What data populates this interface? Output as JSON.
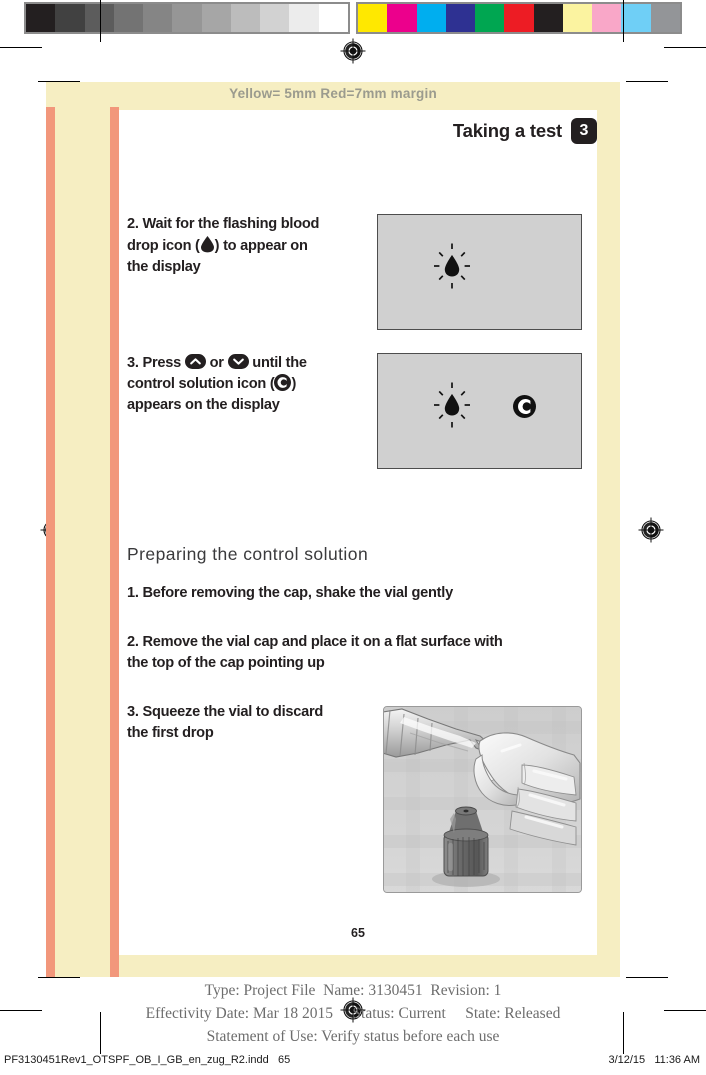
{
  "prepress": {
    "margin_note": "Yellow= 5mm  Red=7mm margin",
    "gray_swatches": [
      "#231f20",
      "#414141",
      "#5c5c5c",
      "#737373",
      "#858585",
      "#969696",
      "#a6a6a6",
      "#bcbcbc",
      "#d2d2d2",
      "#ececec",
      "#ffffff"
    ],
    "color_swatches": [
      "#ffe800",
      "#ec008c",
      "#00aeef",
      "#2e3192",
      "#00a651",
      "#ed1c24",
      "#231f20",
      "#fbf3a0",
      "#f9a7c8",
      "#6fcff6",
      "#939598"
    ],
    "bleed_color": "#f6eec2",
    "red_margin_color": "#f2977b"
  },
  "header": {
    "title": "Taking a test",
    "chapter_number": "3"
  },
  "steps": [
    {
      "id": "step-2",
      "lines": [
        "2. Wait for the flashing blood",
        "drop icon (●) to appear on",
        "the display"
      ]
    },
    {
      "id": "step-3",
      "lines": [
        "3. Press ▲ or ▼ until the",
        "control solution icon (C)",
        "appears on the display"
      ]
    }
  ],
  "section": {
    "heading": "Preparing the control solution",
    "items": [
      {
        "id": "prep-1",
        "lines": [
          "1. Before removing the cap, shake the vial gently"
        ]
      },
      {
        "id": "prep-2",
        "lines": [
          "2. Remove the vial cap and place it on a flat surface with",
          "the top of the cap pointing up"
        ]
      },
      {
        "id": "prep-3",
        "lines": [
          "3. Squeeze the vial to discard",
          "the first drop"
        ]
      }
    ]
  },
  "displays": {
    "display_1": {
      "icons": [
        "flashing-blood-drop"
      ]
    },
    "display_2": {
      "icons": [
        "flashing-blood-drop",
        "control-solution-c"
      ]
    }
  },
  "illustration": {
    "alt": "Hand squeezing a control solution vial to discard the first drop, with the vial cap standing upright on the table"
  },
  "page_number": "65",
  "footer": {
    "stamp_line_1": "Type: Project File  Name: 3130451  Revision: 1",
    "stamp_line_2": "Effectivity Date: Mar 18 2015     Status: Current     State: Released",
    "stamp_line_3": "Statement of Use: Verify status before each use",
    "file_name": "PF3130451Rev1_OTSPF_OB_I_GB_en_zug_R2.indd   65",
    "timestamp": "3/12/15   11:36 AM"
  }
}
